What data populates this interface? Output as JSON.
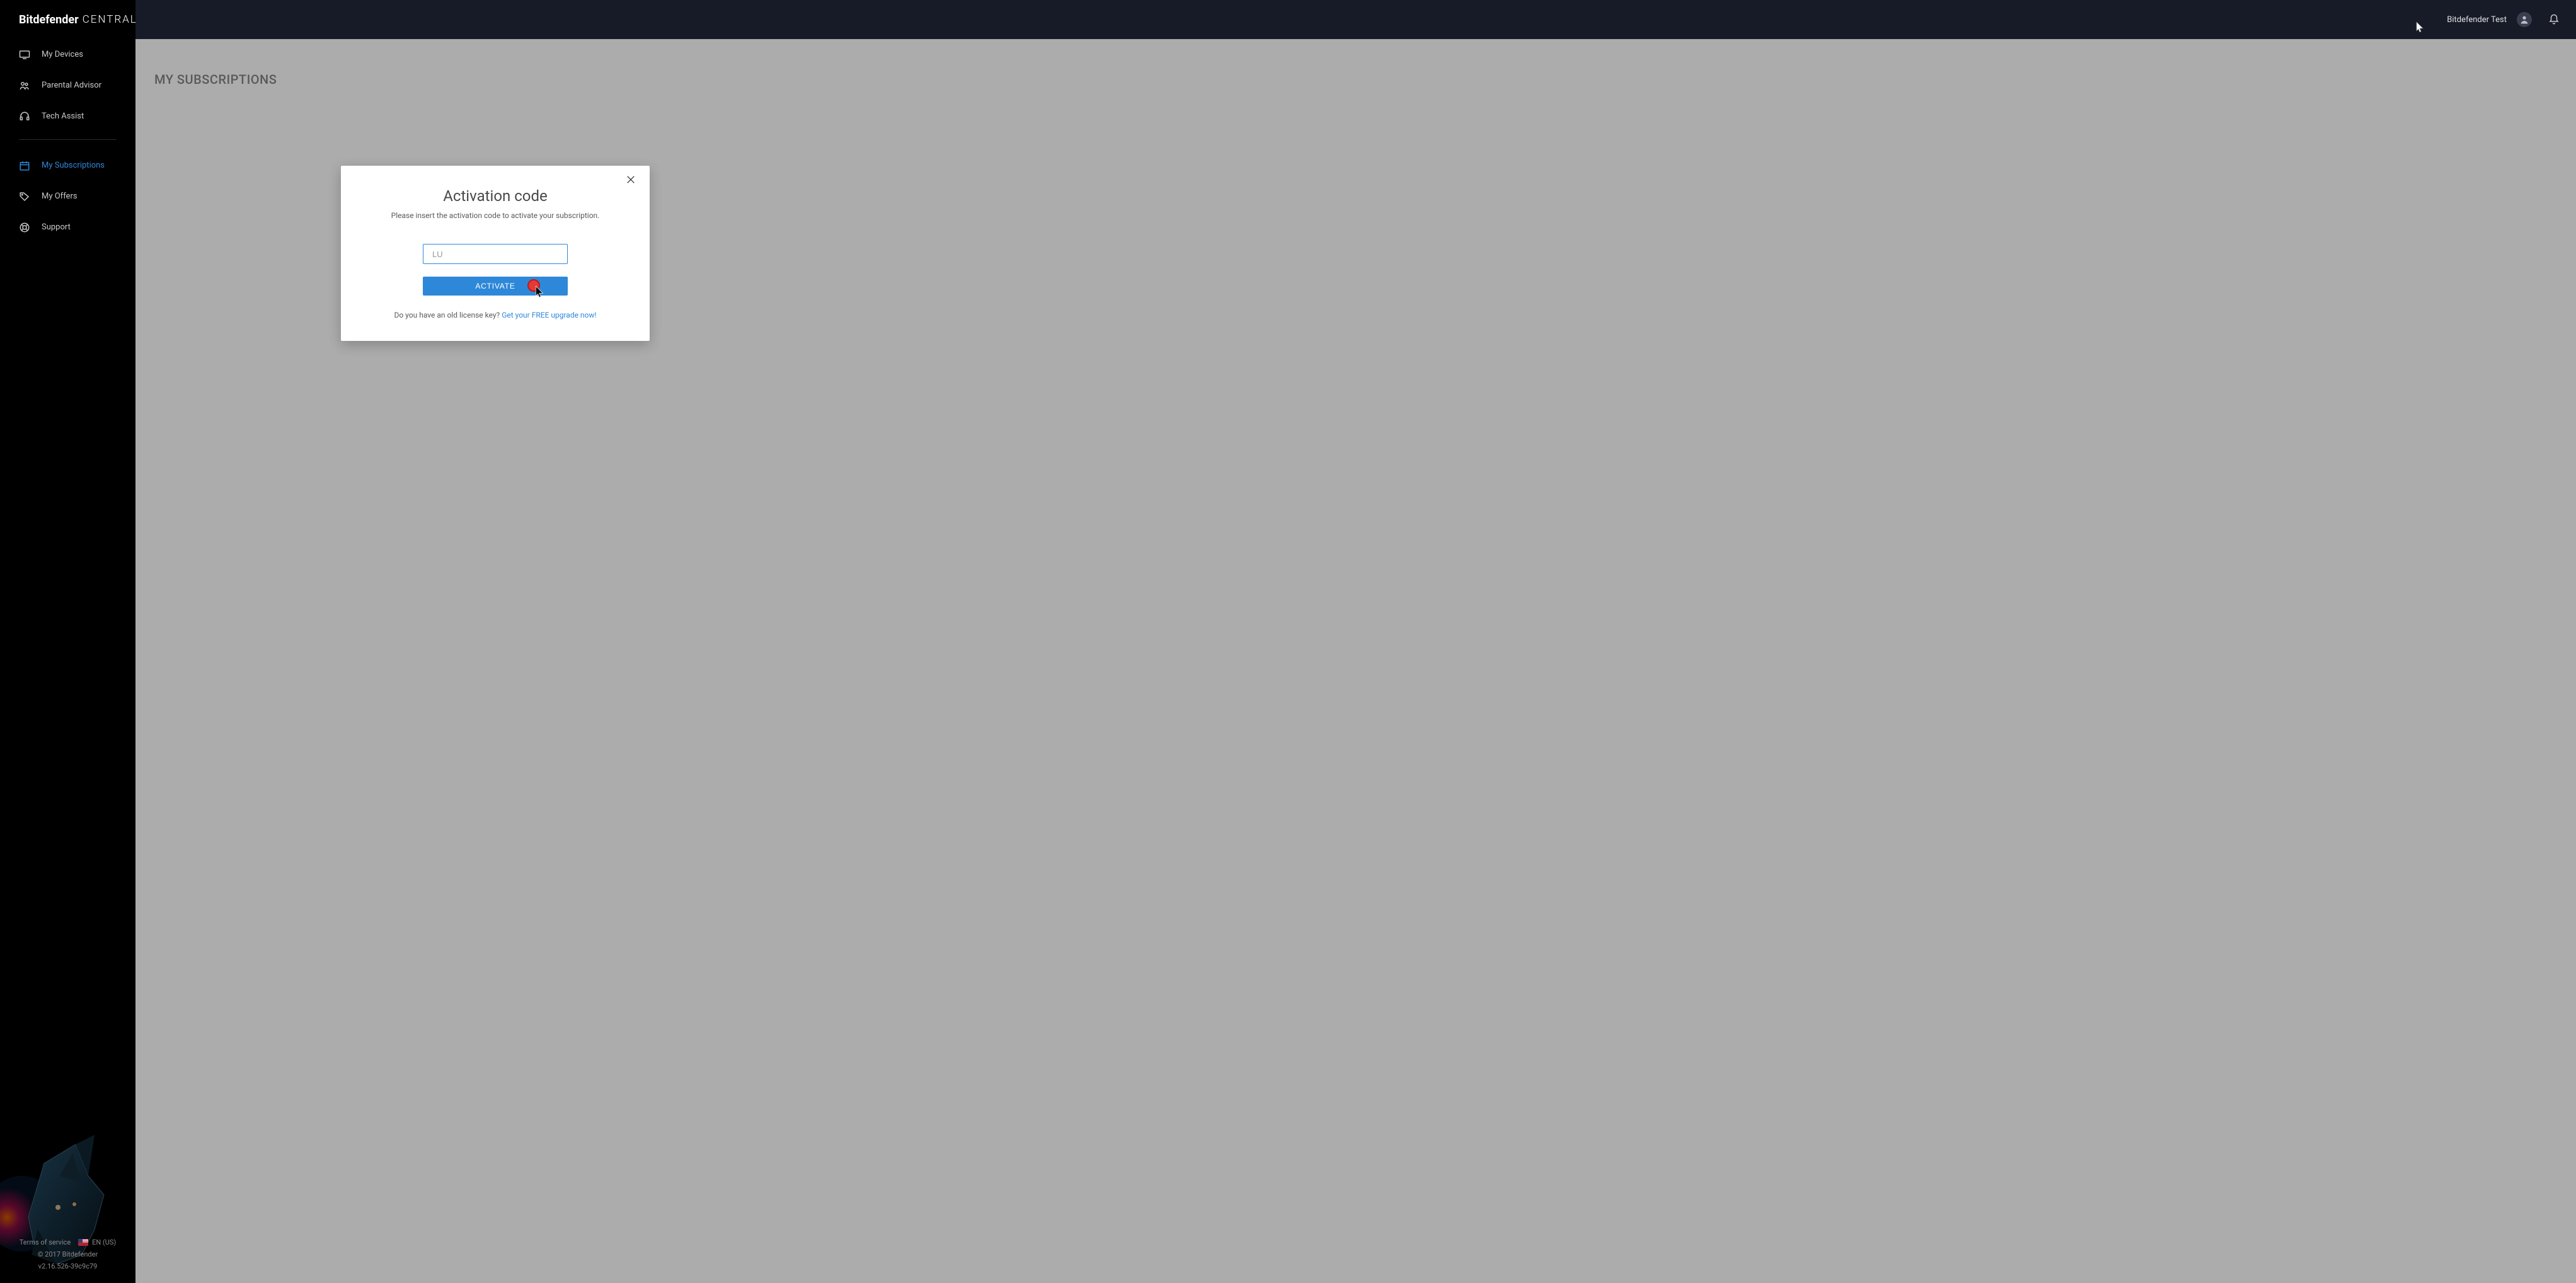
{
  "brand": {
    "strong": "Bitdefender",
    "light": "CENTRAL"
  },
  "sidebar": {
    "items": [
      {
        "label": "My Devices"
      },
      {
        "label": "Parental Advisor"
      },
      {
        "label": "Tech Assist"
      },
      {
        "label": "My Subscriptions"
      },
      {
        "label": "My Offers"
      },
      {
        "label": "Support"
      }
    ]
  },
  "footer": {
    "terms": "Terms of service",
    "lang": "EN (US)",
    "copyright": "© 2017 Bitdefender",
    "version": "v2.16.526-39c9c79"
  },
  "header": {
    "user_name": "Bitdefender Test"
  },
  "main": {
    "title": "MY SUBSCRIPTIONS"
  },
  "modal": {
    "title": "Activation code",
    "subtitle": "Please insert the activation code to activate your subscription.",
    "input_value": "LU",
    "activate_label": "ACTIVATE",
    "footer_question": "Do you have an old license key? ",
    "footer_link": "Get your FREE upgrade now!"
  },
  "colors": {
    "accent": "#2e88d9"
  }
}
